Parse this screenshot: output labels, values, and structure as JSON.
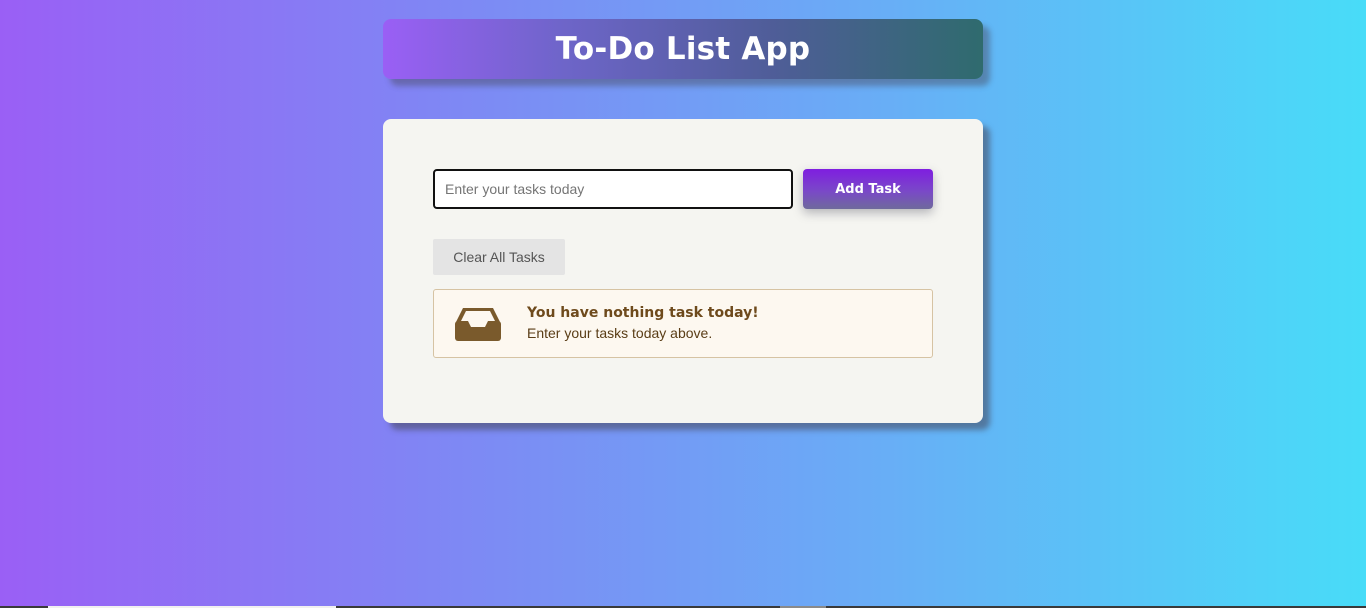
{
  "header": {
    "title": "To-Do List App"
  },
  "form": {
    "input_placeholder": "Enter your tasks today",
    "input_value": "",
    "add_button_label": "Add Task"
  },
  "actions": {
    "clear_button_label": "Clear All Tasks"
  },
  "empty_state": {
    "icon": "inbox-icon",
    "title": "You have nothing task today!",
    "subtitle": "Enter your tasks today above."
  },
  "colors": {
    "accent": "#7f1ee0",
    "notice_text": "#6e4a1c",
    "notice_border": "#d6c3a3",
    "card_background": "#f5f5f1"
  }
}
